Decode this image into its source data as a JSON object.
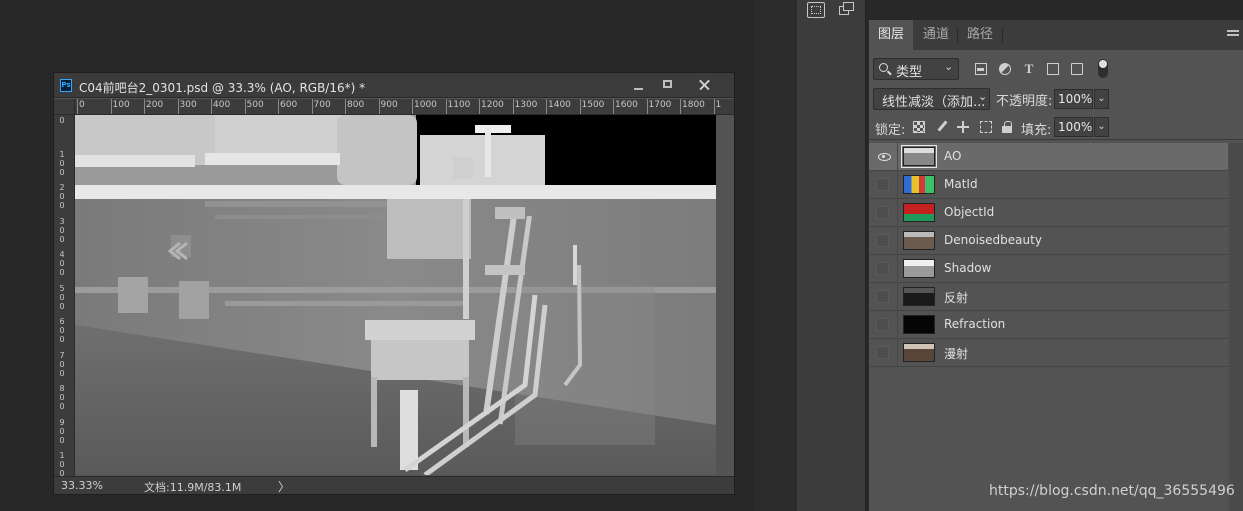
{
  "document": {
    "title": "C04前吧台2_0301.psd @ 33.3% (AO, RGB/16*) *",
    "app_badge": "Ps",
    "ruler_h_labels": [
      "0",
      "100",
      "200",
      "300",
      "400",
      "500",
      "600",
      "700",
      "800",
      "900",
      "1000",
      "1100",
      "1200",
      "1300",
      "1400",
      "1500",
      "1600",
      "1700",
      "1800",
      "1"
    ],
    "ruler_v_labels": [
      "0",
      "100",
      "200",
      "300",
      "400",
      "500",
      "600",
      "700",
      "800",
      "900",
      "1000"
    ],
    "status": {
      "zoom": "33.33%",
      "doc_info": "文档:11.9M/83.1M",
      "arrow": "〉"
    }
  },
  "layers_panel": {
    "tabs": [
      {
        "label": "图层",
        "active": true
      },
      {
        "label": "通道",
        "active": false
      },
      {
        "label": "路径",
        "active": false
      }
    ],
    "filter": {
      "label": "类型",
      "chevron": "⌄"
    },
    "blend_mode": {
      "value": "线性减淡（添加...",
      "chevron": "⌄"
    },
    "opacity": {
      "label": "不透明度:",
      "value": "100%"
    },
    "lock": {
      "label": "锁定:"
    },
    "fill": {
      "label": "填充:",
      "value": "100%"
    },
    "layers": [
      {
        "name": "AO",
        "visible": true,
        "selected": true,
        "thumb": "ao"
      },
      {
        "name": "MatId",
        "visible": false,
        "selected": false,
        "thumb": "matid"
      },
      {
        "name": "ObjectId",
        "visible": false,
        "selected": false,
        "thumb": "objectid"
      },
      {
        "name": "Denoisedbeauty",
        "visible": false,
        "selected": false,
        "thumb": "beauty"
      },
      {
        "name": "Shadow",
        "visible": false,
        "selected": false,
        "thumb": "shadow"
      },
      {
        "name": "反射",
        "visible": false,
        "selected": false,
        "thumb": "reflect"
      },
      {
        "name": "Refraction",
        "visible": false,
        "selected": false,
        "thumb": "refraction"
      },
      {
        "name": "漫射",
        "visible": false,
        "selected": false,
        "thumb": "diffuse"
      }
    ]
  },
  "watermark": "https://blog.csdn.net/qq_36555496",
  "colors": {
    "app_bg": "#282828",
    "panel_bg": "#535353",
    "selected_row": "#6a6a6a",
    "ps_badge": "#31a8ff"
  },
  "icons": [
    "ps-app-icon",
    "minimize-icon",
    "maximize-icon",
    "close-icon",
    "search-icon",
    "pixel-filter-icon",
    "adjustment-filter-icon",
    "type-filter-icon",
    "shape-filter-icon",
    "smart-object-filter-icon",
    "lock-transparent-icon",
    "lock-paint-icon",
    "lock-move-icon",
    "lock-artboard-icon",
    "lock-all-icon",
    "eye-icon",
    "panel-menu-icon"
  ]
}
